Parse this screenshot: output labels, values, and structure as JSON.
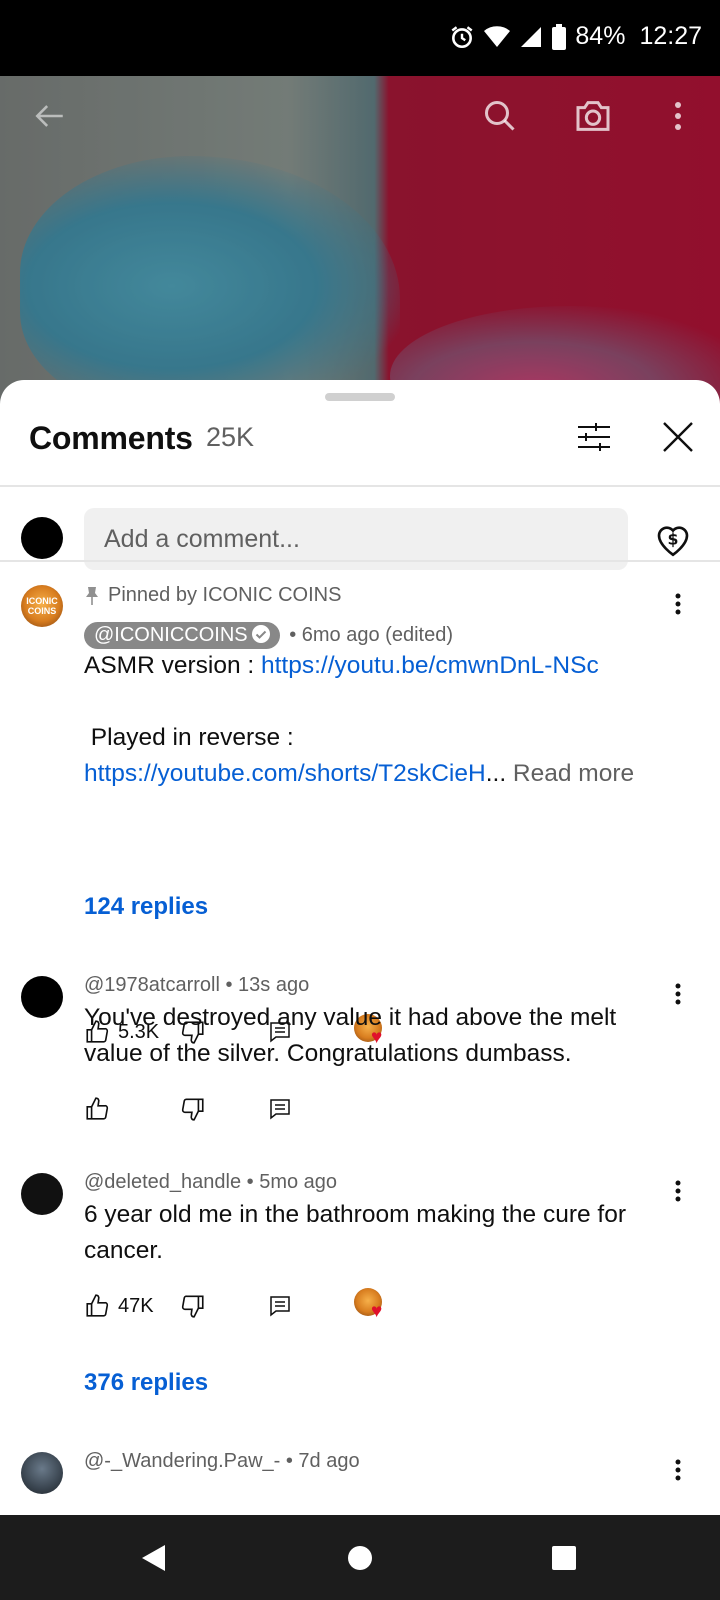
{
  "status_bar": {
    "battery": "84%",
    "time": "12:27"
  },
  "sheet": {
    "title": "Comments",
    "count": "25K"
  },
  "composer": {
    "placeholder": "Add a comment..."
  },
  "comments": [
    {
      "pinned_label": "Pinned by ICONIC COINS",
      "handle": "@ICONICCOINS",
      "meta": "• 6mo ago (edited)",
      "avatar_text": "ICONIC COINS",
      "line1_prefix": "ASMR version : ",
      "line1_link": "https://youtu.be/cmwnDnL-NSc",
      "line2": " Played in reverse :",
      "line3_link": "https://youtube.com/shorts/T2skCieH",
      "line3_ellipsis": "...",
      "read_more": " Read more",
      "likes": "5.3K",
      "replies": "124 replies"
    },
    {
      "meta": "@1978atcarroll • 13s ago",
      "text": "You've destroyed any value it had above the melt value of the silver. Congratulations dumbass."
    },
    {
      "meta": "@deleted_handle • 5mo ago",
      "text": "6 year old me in the bathroom making the cure for cancer.",
      "likes": "47K",
      "replies": "376 replies"
    },
    {
      "meta": "@-_Wandering.Paw_- • 7d ago"
    }
  ],
  "colors": {
    "link": "#065fd4",
    "heart": "#e0102b"
  }
}
